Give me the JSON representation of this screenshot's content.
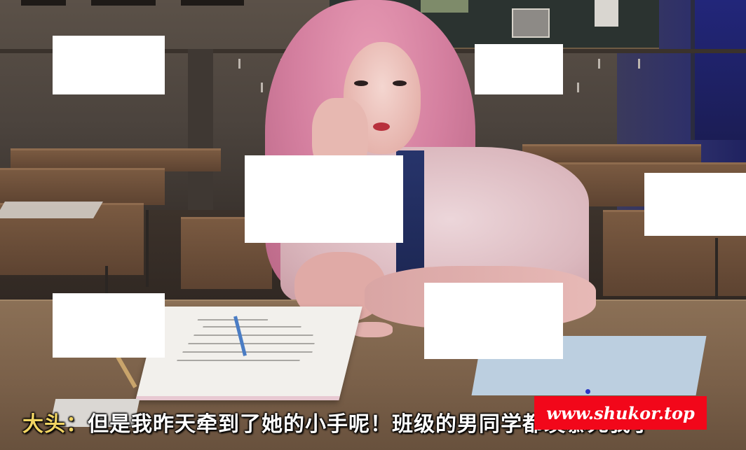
{
  "dialogue": {
    "speaker": "大头",
    "separator": "：",
    "line": "但是我昨天牵到了她的小手呢！班级的男同学都羡慕死我了"
  },
  "watermark": {
    "text": "www.shukor.top",
    "background_color": "#f2071a"
  },
  "colors": {
    "speaker_name": "#f1d463",
    "dialogue_text": "#ffffff"
  }
}
